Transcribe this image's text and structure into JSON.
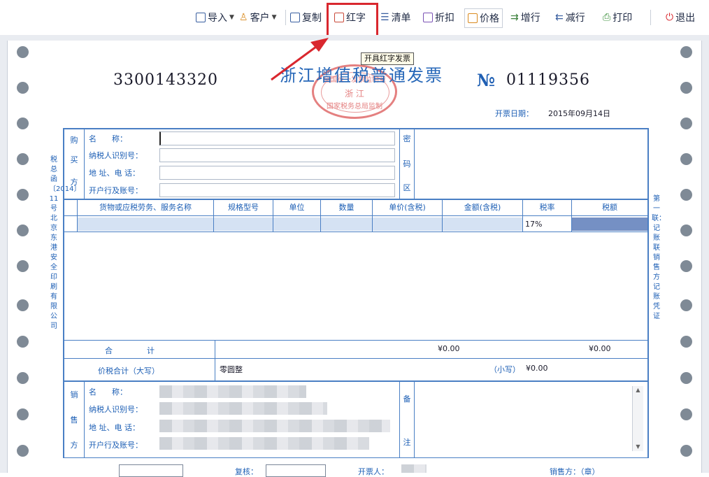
{
  "toolbar": {
    "import": "导入",
    "customer": "客户",
    "copy": "复制",
    "red": "红字",
    "list": "清单",
    "discount": "折扣",
    "price": "价格",
    "add_row": "增行",
    "del_row": "减行",
    "print": "打印",
    "exit": "退出"
  },
  "tooltip": "开具红字发票",
  "invoice": {
    "code": "3300143320",
    "title": "浙江增值税普通发票",
    "no_mark": "№",
    "number": "01119356",
    "date_label": "开票日期：",
    "date": "2015年09月14日",
    "seal_top": "全国统一发票监制章",
    "seal_mid": "浙 江",
    "seal_bottom": "国家税务总局监制",
    "buyer": {
      "side": [
        "购",
        "买",
        "方"
      ],
      "name": "名　　称：",
      "tax_id": "纳税人识别号：",
      "address": "地 址、电 话：",
      "bank": "开户行及账号："
    },
    "cipher_side": [
      "密",
      "码",
      "区"
    ],
    "columns": [
      "货物或应税劳务、服务名称",
      "规格型号",
      "单位",
      "数量",
      "单价(含税)",
      "金额(含税)",
      "税率",
      "税额"
    ],
    "row1_tax_rate": "17%",
    "total_label": "合　　　　计",
    "total_amount": "¥0.00",
    "total_tax": "¥0.00",
    "tax_total_label": "价税合计（大写）",
    "tax_total_upper": "零圆整",
    "tax_total_small_label": "（小写）",
    "tax_total_small": "¥0.00",
    "seller": {
      "side": [
        "销",
        "售",
        "方"
      ],
      "name": "名　　称：",
      "tax_id": "纳税人识别号：",
      "address": "地 址、电 话：",
      "bank": "开户行及账号："
    },
    "remark_side": [
      "备",
      "注"
    ],
    "left_side_text": "税总函〔2014〕11号北京东港安全印刷有限公司",
    "right_side_text": "第一联：记账联 销售方记账凭证",
    "bottom_review": "复核：",
    "bottom_issuer": "开票人：",
    "bottom_seller": "销售方：（章）"
  },
  "colors": {
    "highlight": "#d9272e",
    "form_blue": "#1d5fb5",
    "seal_red": "#e06a6a"
  }
}
